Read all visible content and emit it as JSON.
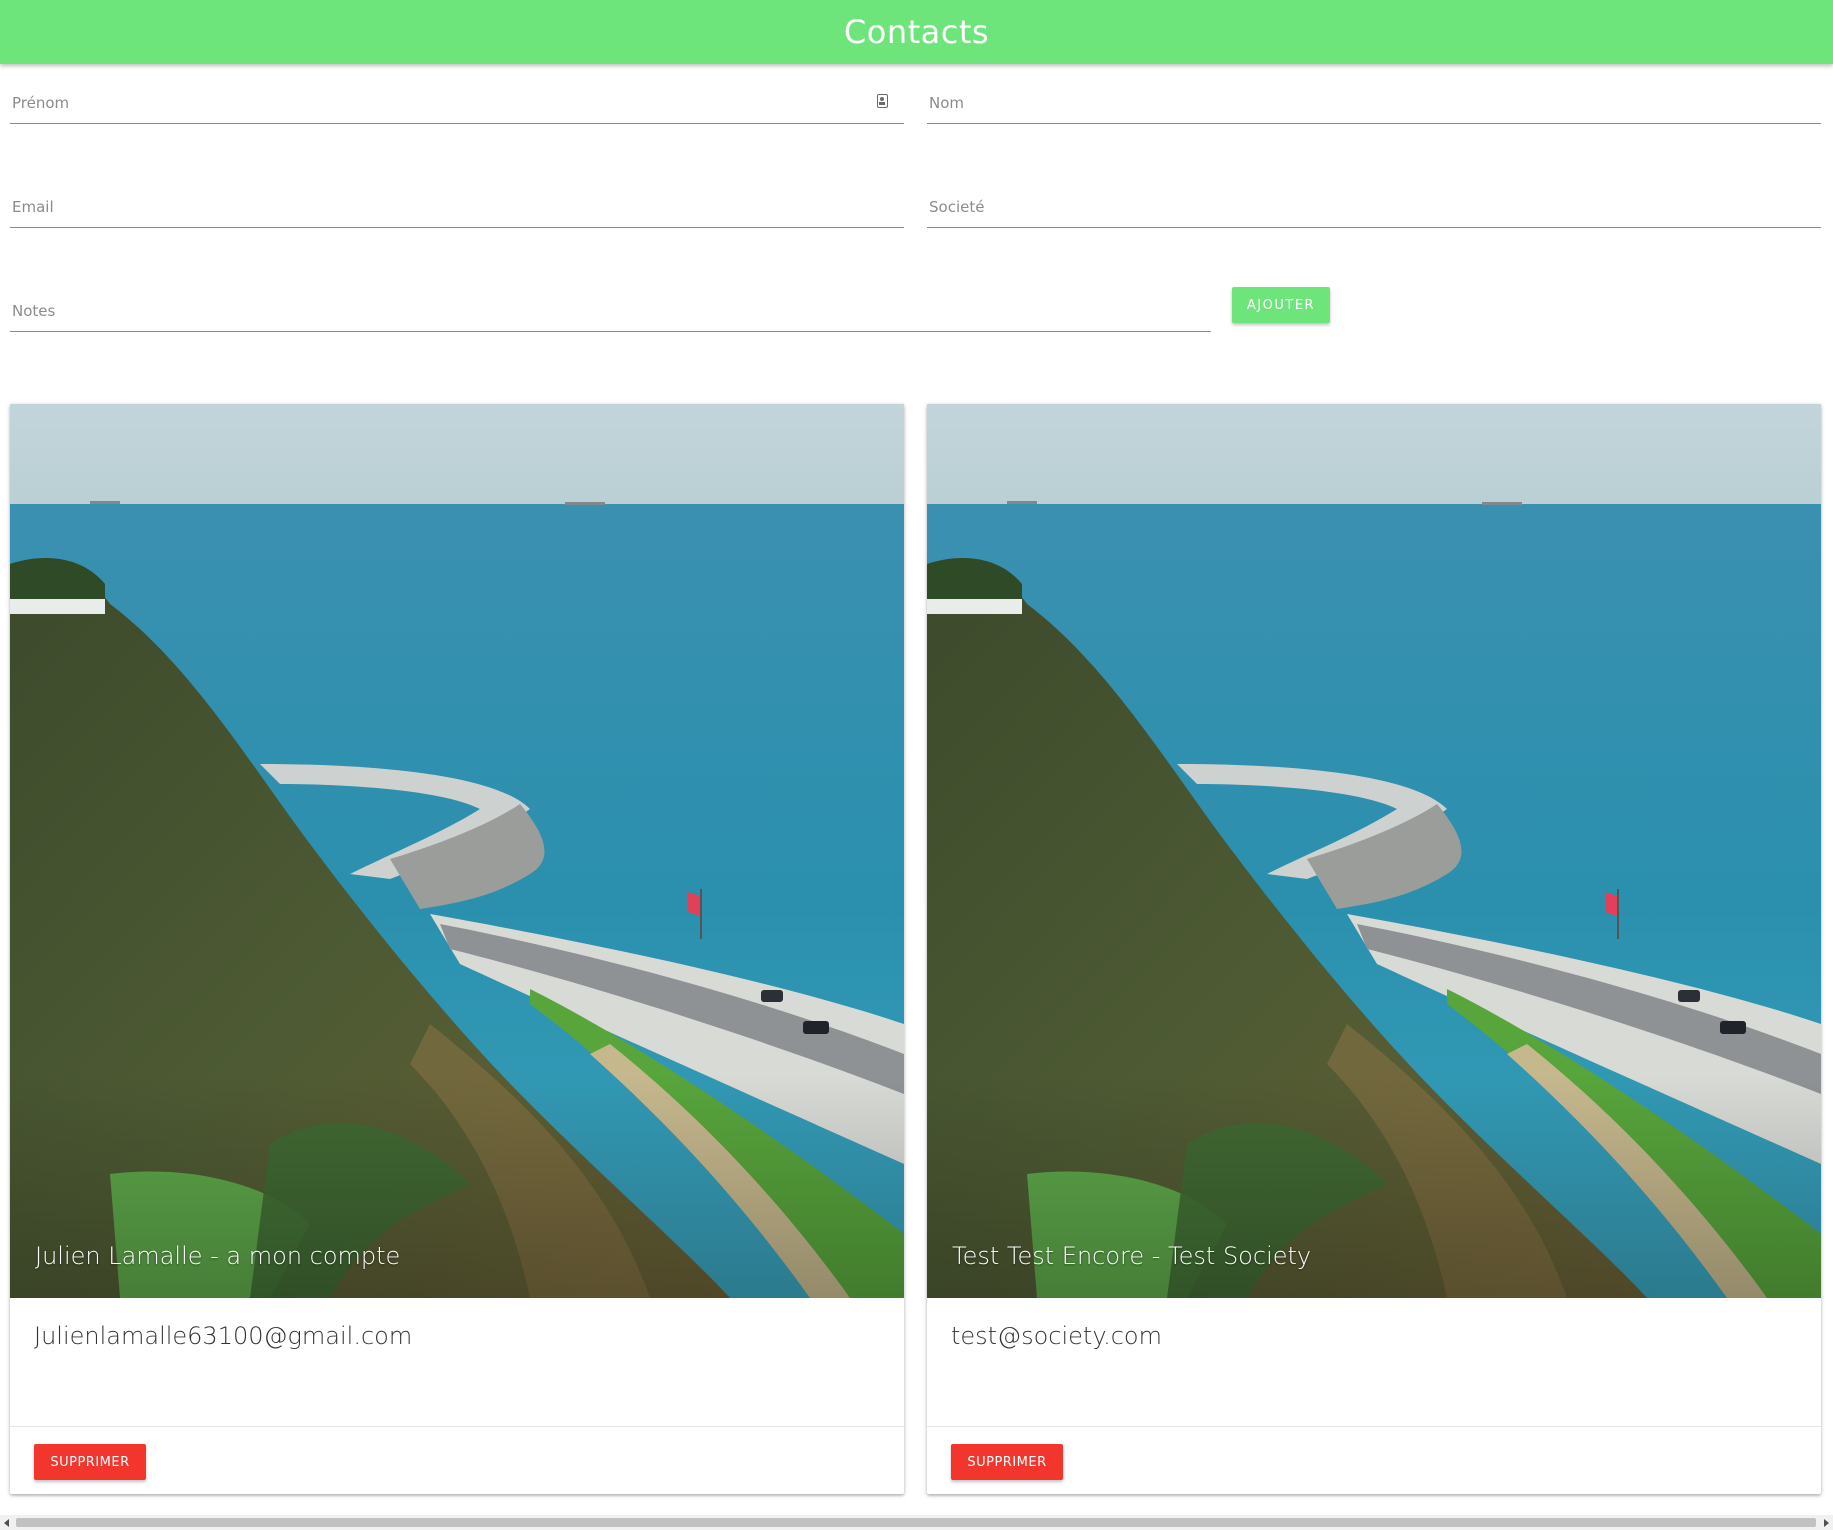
{
  "app": {
    "title": "Contacts"
  },
  "form": {
    "prenom_label": "Prénom",
    "nom_label": "Nom",
    "email_label": "Email",
    "societe_label": "Societé",
    "notes_label": "Notes",
    "add_label": "Ajouter"
  },
  "contacts": [
    {
      "title": "Julien Lamalle - a mon compte",
      "email": "Julienlamalle63100@gmail.com",
      "delete_label": "Supprimer"
    },
    {
      "title": "Test Test Encore - Test Society",
      "email": "test@society.com",
      "delete_label": "Supprimer"
    }
  ],
  "colors": {
    "accent": "#6de57b",
    "danger": "#f2362e"
  },
  "icons": {
    "prenom_field_icon": "contact-card-icon"
  }
}
